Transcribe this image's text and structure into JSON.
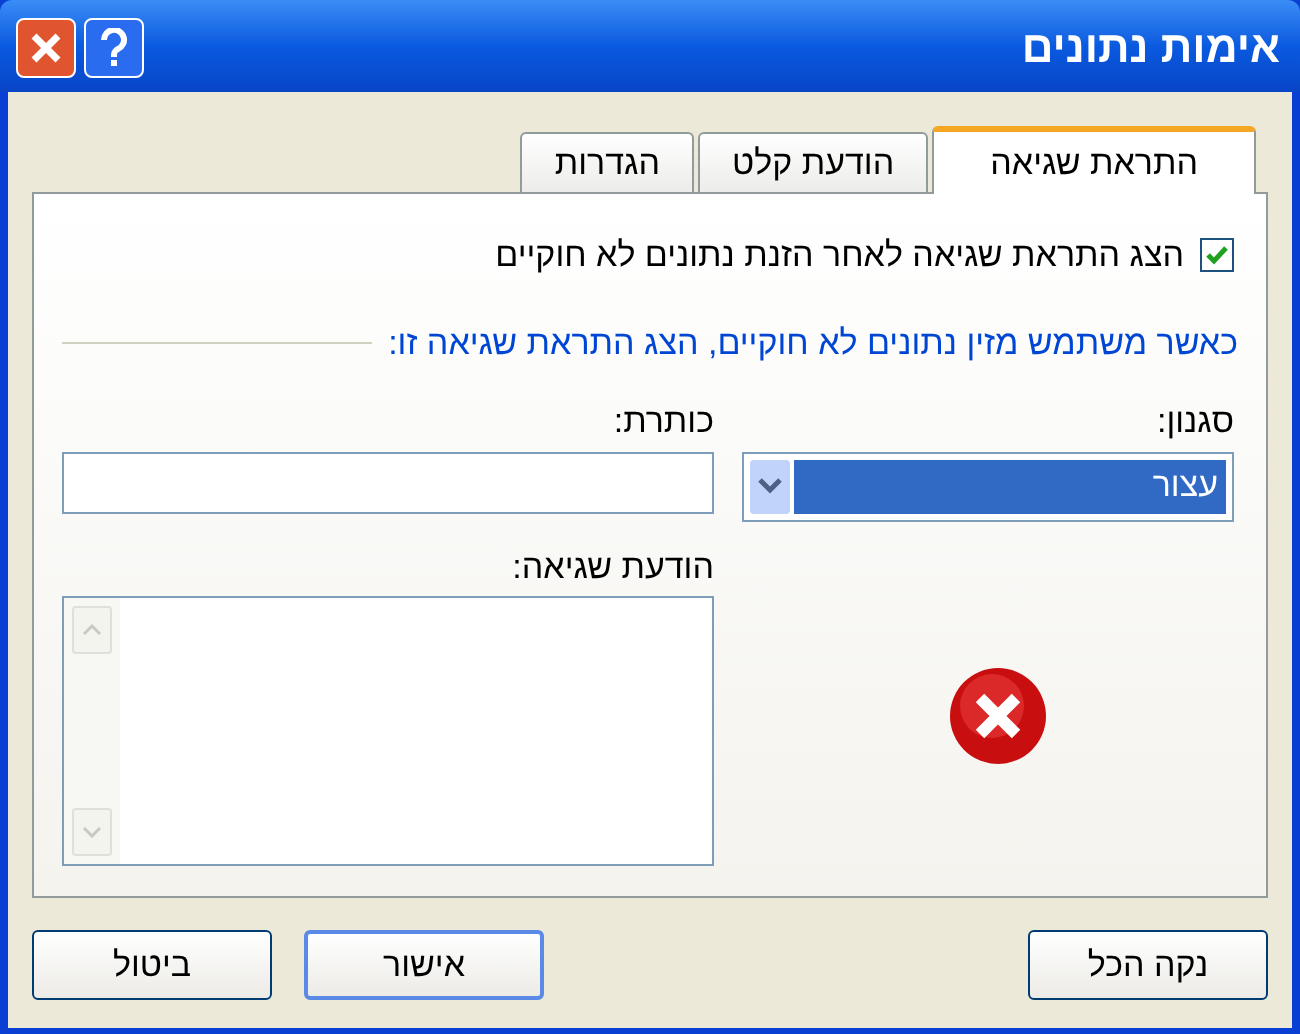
{
  "window": {
    "title": "אימות נתונים"
  },
  "tabs": [
    {
      "label": "התראת שגיאה",
      "selected": true
    },
    {
      "label": "הודעת קלט",
      "selected": false
    },
    {
      "label": "הגדרות",
      "selected": false
    }
  ],
  "show_error_alert": {
    "label": "הצג התראת שגיאה לאחר הזנת נתונים לא חוקיים",
    "checked": true
  },
  "group_label": "כאשר משתמש מזין נתונים לא חוקיים, הצג התראת שגיאה זו:",
  "style": {
    "label": "סגנון:",
    "value": "עצור"
  },
  "title_field": {
    "label": "כותרת:"
  },
  "error_message": {
    "label": "הודעת שגיאה:"
  },
  "buttons": {
    "clear_all": "נקה הכל",
    "ok": "אישור",
    "cancel": "ביטול"
  }
}
